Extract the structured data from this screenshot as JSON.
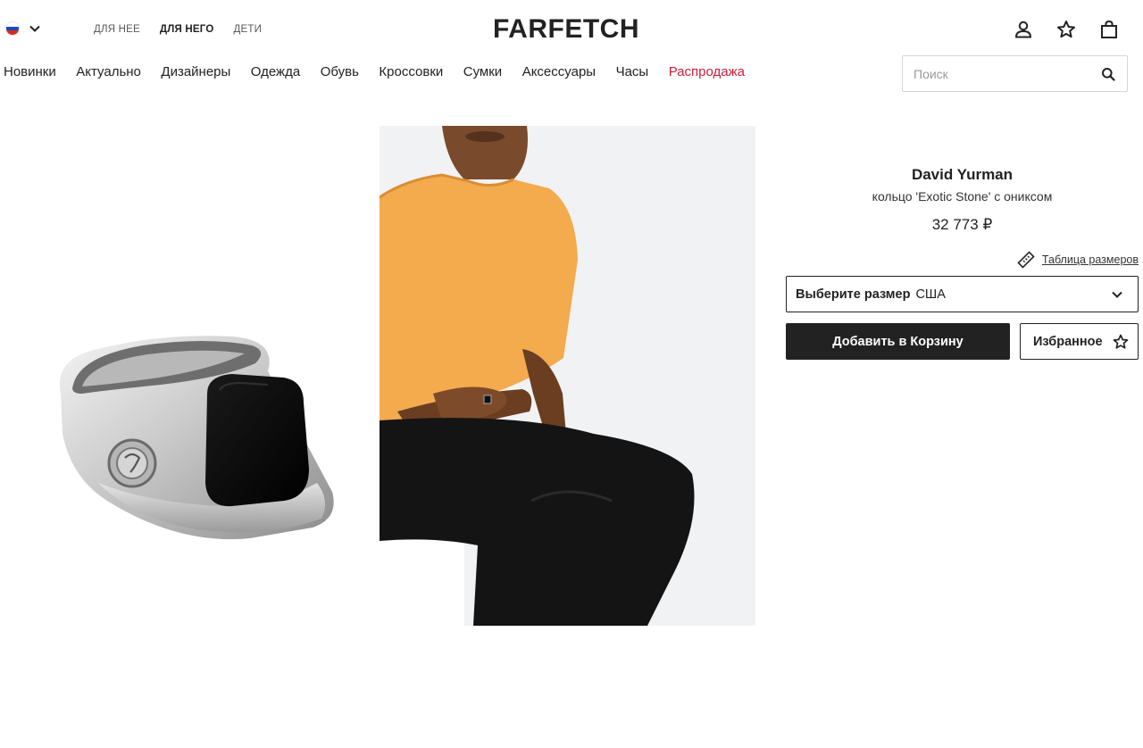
{
  "header": {
    "locale_flag": "russia-flag",
    "gender_tabs": [
      {
        "label": "ДЛЯ НЕЕ",
        "active": false
      },
      {
        "label": "ДЛЯ НЕГО",
        "active": true
      },
      {
        "label": "ДЕТИ",
        "active": false
      }
    ],
    "logo": "FARFETCH",
    "icons": [
      "account-icon",
      "wishlist-star-icon",
      "bag-icon"
    ]
  },
  "nav": {
    "items": [
      "Новинки",
      "Актуально",
      "Дизайнеры",
      "Одежда",
      "Обувь",
      "Кроссовки",
      "Сумки",
      "Аксессуары",
      "Часы",
      "Распродажа"
    ],
    "sale_color": "#cb1f3a"
  },
  "search": {
    "value": "",
    "placeholder": "Поиск"
  },
  "product": {
    "brand": "David Yurman",
    "name": "кольцо 'Exotic Stone' с ониксом",
    "price": "32 773 ₽",
    "size_guide": "Таблица размеров",
    "size_select_label": "Выберите размер",
    "size_select_value": "США",
    "add_to_cart": "Добавить в Корзину",
    "wishlist": "Избранное"
  },
  "colors": {
    "primary": "#222222",
    "sale": "#cb1f3a"
  }
}
